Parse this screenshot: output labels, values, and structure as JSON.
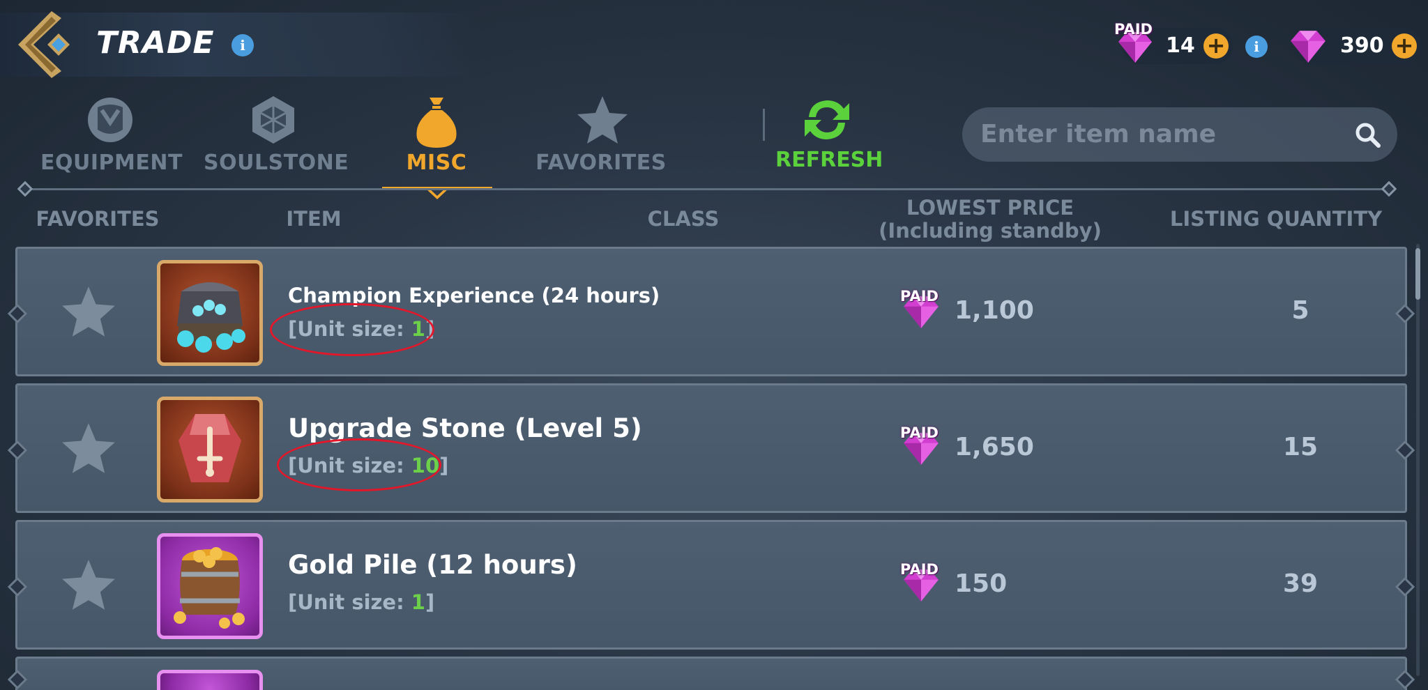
{
  "header": {
    "title": "TRADE",
    "paid_tag": "PAID",
    "paid_currency": "14",
    "gem_currency": "390"
  },
  "tabs": [
    {
      "label": "EQUIPMENT",
      "icon": "armor-icon",
      "active": false
    },
    {
      "label": "SOULSTONE",
      "icon": "soulstone-icon",
      "active": false
    },
    {
      "label": "MISC",
      "icon": "money-bag-icon",
      "active": true
    },
    {
      "label": "FAVORITES",
      "icon": "star-icon",
      "active": false
    }
  ],
  "refresh_label": "REFRESH",
  "search": {
    "placeholder": "Enter item name"
  },
  "columns": {
    "favorites": "FAVORITES",
    "item": "ITEM",
    "class": "CLASS",
    "lowest_price_line1": "LOWEST PRICE",
    "lowest_price_line2": "(Including standby)",
    "listing_quantity": "LISTING QUANTITY"
  },
  "rows": [
    {
      "name": "Champion Experience (24 hours)",
      "unit_prefix": "[Unit size: ",
      "unit_size": "1",
      "unit_suffix": "]",
      "price_tag": "PAID",
      "price": "1,100",
      "quantity": "5",
      "icon": "xp-chest-icon",
      "circled": true
    },
    {
      "name": "Upgrade Stone (Level 5)",
      "unit_prefix": "[Unit size: ",
      "unit_size": "10",
      "unit_suffix": "]",
      "price_tag": "PAID",
      "price": "1,650",
      "quantity": "15",
      "icon": "upgrade-stone-icon",
      "circled": true
    },
    {
      "name": "Gold Pile (12 hours)",
      "unit_prefix": "[Unit size: ",
      "unit_size": "1",
      "unit_suffix": "]",
      "price_tag": "PAID",
      "price": "150",
      "quantity": "39",
      "icon": "gold-barrel-icon",
      "circled": false
    }
  ],
  "colors": {
    "accent": "#f0a72c",
    "refresh": "#5bd13c",
    "unit_number": "#6dd04a",
    "annotation_circle": "#e3172a"
  }
}
